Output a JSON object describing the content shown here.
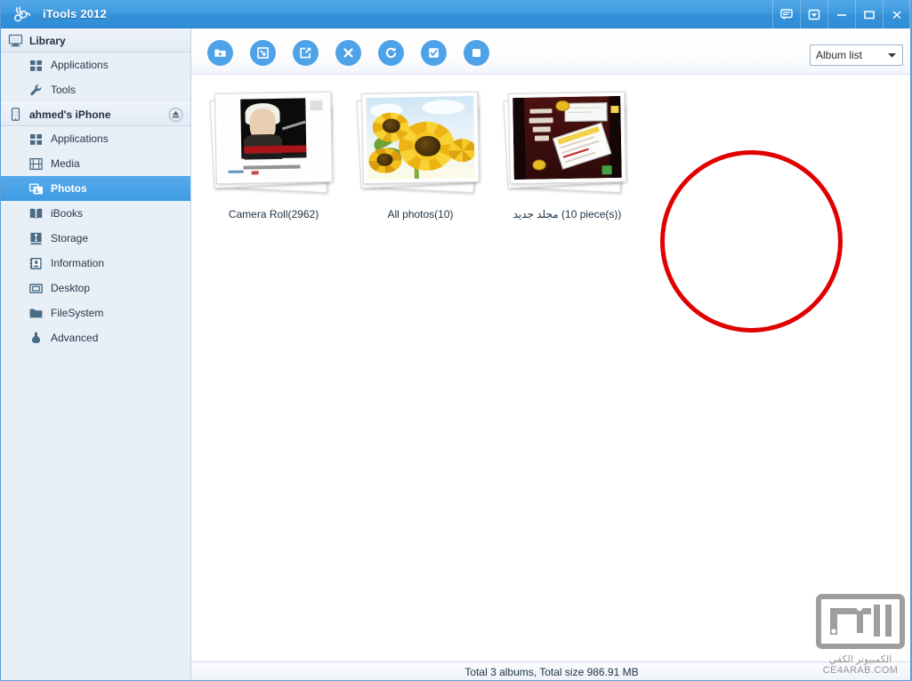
{
  "window": {
    "title": "iTools 2012",
    "logo_icon": "rabbit-logo-icon",
    "buttons": [
      {
        "name": "feedback-button",
        "icon": "speech-bubble-icon",
        "label": ""
      },
      {
        "name": "downloads-button",
        "icon": "download-box-icon",
        "label": ""
      },
      {
        "name": "minimize-button",
        "icon": "minimize-icon",
        "label": ""
      },
      {
        "name": "maximize-button",
        "icon": "maximize-icon",
        "label": ""
      },
      {
        "name": "close-button",
        "icon": "close-icon",
        "label": ""
      }
    ]
  },
  "sidebar": {
    "groups": [
      {
        "label": "Library",
        "icon": "monitor-icon",
        "has_eject": false,
        "items": [
          {
            "label": "Applications",
            "icon": "grid-apps-icon",
            "selected": false
          },
          {
            "label": "Tools",
            "icon": "wrench-icon",
            "selected": false
          }
        ]
      },
      {
        "label": "ahmed's iPhone",
        "icon": "iphone-icon",
        "has_eject": true,
        "eject_icon": "eject-icon",
        "items": [
          {
            "label": "Applications",
            "icon": "grid-apps-icon",
            "selected": false
          },
          {
            "label": "Media",
            "icon": "film-icon",
            "selected": false
          },
          {
            "label": "Photos",
            "icon": "photos-icon",
            "selected": true
          },
          {
            "label": "iBooks",
            "icon": "book-icon",
            "selected": false
          },
          {
            "label": "Storage",
            "icon": "usb-icon",
            "selected": false
          },
          {
            "label": "Information",
            "icon": "contact-card-icon",
            "selected": false
          },
          {
            "label": "Desktop",
            "icon": "screen-icon",
            "selected": false
          },
          {
            "label": "FileSystem",
            "icon": "folder-icon",
            "selected": false
          },
          {
            "label": "Advanced",
            "icon": "flask-icon",
            "selected": false
          }
        ]
      }
    ]
  },
  "toolbar": {
    "buttons": [
      {
        "name": "new-album-button",
        "icon": "new-folder-star-icon",
        "tooltip": "New album"
      },
      {
        "name": "import-button",
        "icon": "import-arrow-icon",
        "tooltip": "Import"
      },
      {
        "name": "export-button",
        "icon": "export-arrow-icon",
        "tooltip": "Export"
      },
      {
        "name": "delete-button",
        "icon": "close-x-icon",
        "tooltip": "Delete"
      },
      {
        "name": "refresh-button",
        "icon": "refresh-icon",
        "tooltip": "Refresh"
      },
      {
        "name": "select-all-button",
        "icon": "checkbox-icon",
        "tooltip": "Select all"
      },
      {
        "name": "stop-button",
        "icon": "stop-square-icon",
        "tooltip": "Stop"
      }
    ],
    "view_selector": {
      "value": "Album list",
      "chevron_icon": "chevron-down-icon"
    }
  },
  "content": {
    "albums": [
      {
        "label": "Camera Roll(2962)",
        "thumb": "camera-roll-thumb",
        "highlighted": false
      },
      {
        "label": "All photos(10)",
        "thumb": "sunflower-thumb",
        "highlighted": false
      },
      {
        "label": "مجلد جديد (10 piece(s))",
        "thumb": "arabic-tutorial-thumb",
        "highlighted": true
      }
    ],
    "annotation": {
      "type": "circle",
      "color": "#e00000",
      "target": "مجلد جديد (10 piece(s))"
    }
  },
  "statusbar": {
    "text": "Total 3 albums, Total size 986.91 MB"
  },
  "watermark": {
    "arabic": "الكمبيوتر الكفي",
    "english": "CE4ARAB.COM"
  },
  "colors": {
    "titlebar": "#3e9bdf",
    "accent": "#4ea3e8",
    "sidebar_bg": "#e9eff7",
    "selected_row": "#3f9ce4",
    "annotation_red": "#e00000"
  }
}
